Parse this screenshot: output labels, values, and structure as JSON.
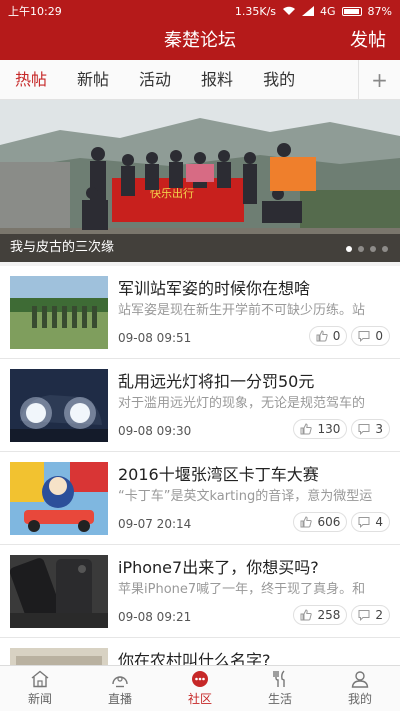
{
  "status": {
    "time": "上午10:29",
    "speed": "1.35K/s",
    "network": "4G",
    "battery": "87%"
  },
  "header": {
    "title": "秦楚论坛",
    "post_label": "发帖"
  },
  "tabs": [
    {
      "label": "热帖",
      "active": true
    },
    {
      "label": "新帖"
    },
    {
      "label": "活动"
    },
    {
      "label": "报料"
    },
    {
      "label": "我的"
    }
  ],
  "banner": {
    "caption": "我与皮古的三次缘",
    "flag_text": "快乐出行",
    "pages": 4,
    "current_page": 1
  },
  "posts": [
    {
      "title": "军训站军姿的时候你在想啥",
      "summary": "站军姿是现在新生开学前不可缺少历练。站",
      "date": "09-08 09:51",
      "likes": "0",
      "comments": "0"
    },
    {
      "title": "乱用远光灯将扣一分罚50元",
      "summary": "对于滥用远光灯的现象，无论是规范驾车的",
      "date": "09-08 09:30",
      "likes": "130",
      "comments": "3"
    },
    {
      "title": "2016十堰张湾区卡丁车大赛",
      "summary": "“卡丁车”是英文karting的音译，意为微型运",
      "date": "09-07 20:14",
      "likes": "606",
      "comments": "4"
    },
    {
      "title": "iPhone7出来了，你想买吗?",
      "summary": "苹果iPhone7喊了一年，终于现了真身。和",
      "date": "09-08 09:21",
      "likes": "258",
      "comments": "2"
    },
    {
      "title": "你在农村叫什么名字?"
    }
  ],
  "nav": [
    {
      "label": "新闻"
    },
    {
      "label": "直播"
    },
    {
      "label": "社区",
      "active": true
    },
    {
      "label": "生活"
    },
    {
      "label": "我的"
    }
  ],
  "colors": {
    "brand": "#b51a1a",
    "active_tab": "#c62828"
  }
}
